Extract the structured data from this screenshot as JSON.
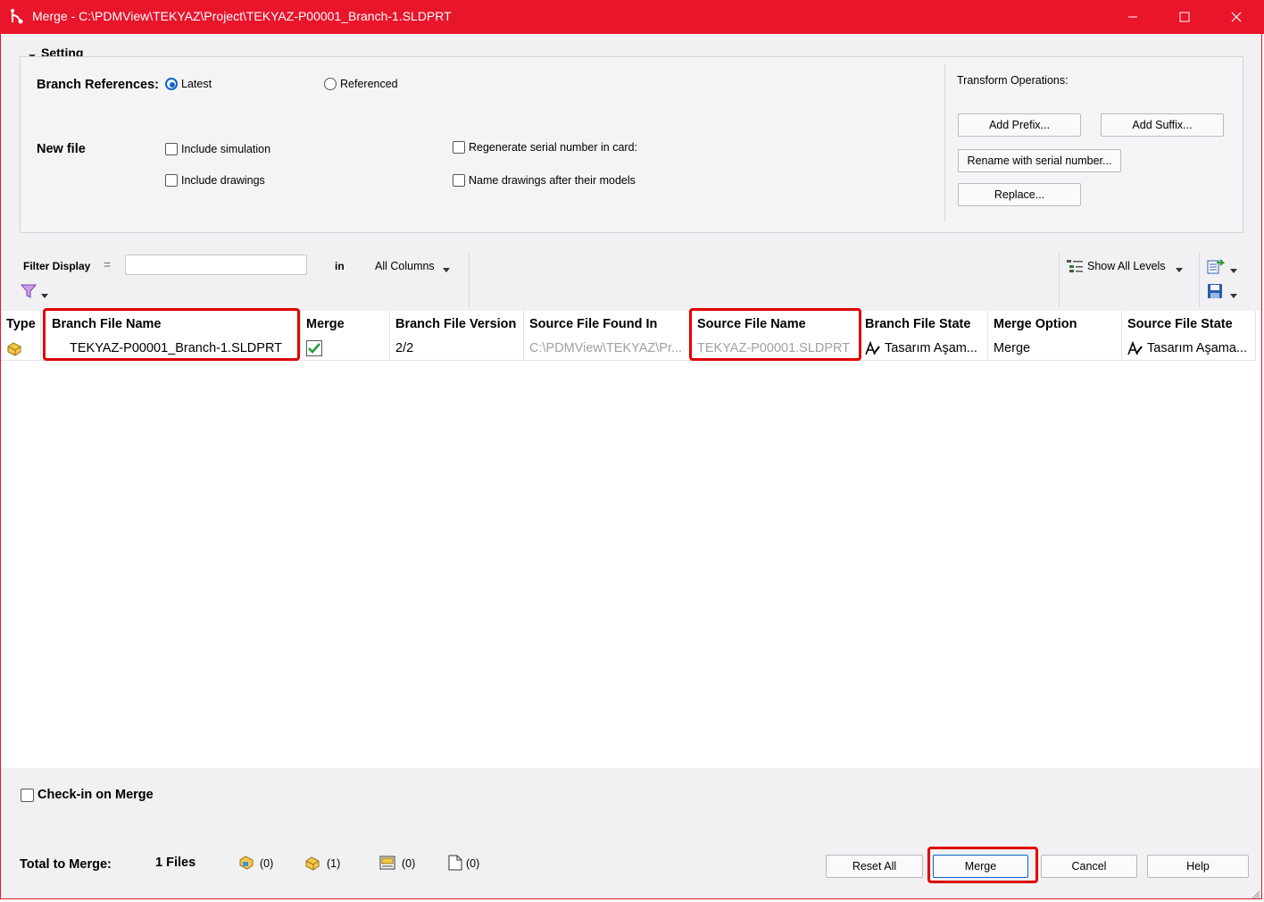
{
  "window": {
    "title": "Merge - C:\\PDMView\\TEKYAZ\\Project\\TEKYAZ-P00001_Branch-1.SLDPRT",
    "app_icon": "pdm-branch-icon",
    "accent": "#e8152b"
  },
  "setting": {
    "header": "Setting",
    "branch_references_label": "Branch References:",
    "radio_latest": "Latest",
    "radio_referenced": "Referenced",
    "selected": "Latest",
    "new_file_label": "New file",
    "include_simulation": "Include simulation",
    "include_drawings": "Include drawings",
    "regenerate_serial": "Regenerate serial number in card:",
    "name_drawings": "Name drawings after their models",
    "transform_label": "Transform Operations:",
    "add_prefix": "Add Prefix...",
    "add_suffix": "Add Suffix...",
    "rename_serial": "Rename with serial number...",
    "replace": "Replace..."
  },
  "filter": {
    "label": "Filter Display",
    "operator": "=",
    "value": "",
    "in_label": "in",
    "columns": "All Columns",
    "show_levels": "Show All Levels"
  },
  "table": {
    "columns": [
      "Type",
      "Branch File Name",
      "Merge",
      "Branch File Version",
      "Source File Found In",
      "Source File Name",
      "Branch File State",
      "Merge Option",
      "Source File State"
    ],
    "rows": [
      {
        "type_icon": "part-icon",
        "branch_file_name": "TEKYAZ-P00001_Branch-1.SLDPRT",
        "merge_checked": true,
        "branch_file_version": "2/2",
        "source_file_found_in": "C:\\PDMView\\TEKYAZ\\Pr...",
        "source_file_name": "TEKYAZ-P00001.SLDPRT",
        "branch_file_state": "Tasarım Aşam...",
        "merge_option": "Merge",
        "source_file_state": "Tasarım Aşama..."
      }
    ]
  },
  "footer": {
    "checkin_label": "Check-in on Merge",
    "total_label": "Total to Merge:",
    "total_files": "1 Files",
    "count_assembly": "(0)",
    "count_part": "(1)",
    "count_drawing": "(0)",
    "count_other": "(0)",
    "reset_all": "Reset All",
    "merge": "Merge",
    "cancel": "Cancel",
    "help": "Help"
  }
}
